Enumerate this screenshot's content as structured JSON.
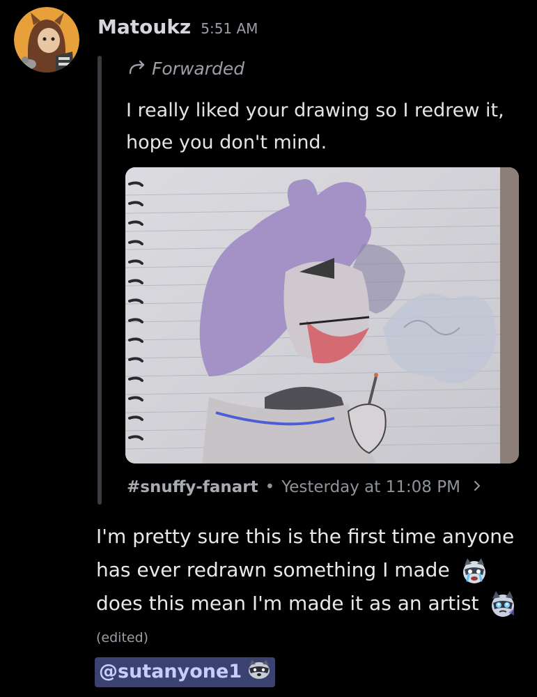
{
  "author": {
    "name": "Matoukz",
    "time": "5:51 AM"
  },
  "forwarded": {
    "label": "Forwarded",
    "text": "I really liked your drawing so I redrew it, hope you don't mind.",
    "source_channel": "#snuffy-fanart",
    "separator": "•",
    "source_time": "Yesterday at 11:08 PM"
  },
  "message": {
    "part1": "I'm pretty sure this is the first time anyone has ever redrawn something I made",
    "part2": "does this mean I'm made it as an artist",
    "edited": "(edited)",
    "mention": "@sutanyone1"
  },
  "icons": {
    "forward": "forward-arrow-icon",
    "chevron": "chevron-right-icon",
    "emoji_1": "raccoon-crying-emoji",
    "emoji_2": "raccoon-teary-emoji",
    "emoji_mention": "raccoon-emoji"
  },
  "colors": {
    "background": "#000000",
    "mention_bg": "#3c4270",
    "mention_text": "#c9cdfb",
    "forward_bar": "#3a3c42"
  }
}
